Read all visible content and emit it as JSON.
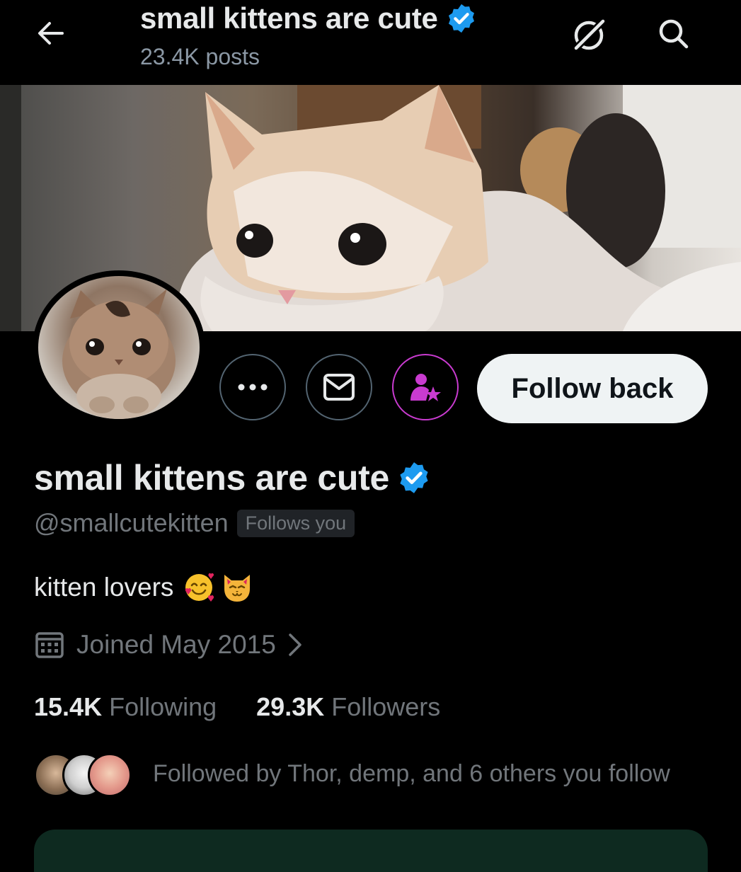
{
  "header": {
    "title": "small kittens are cute",
    "posts": "23.4K posts",
    "back_icon": "arrow-left-icon",
    "grok_icon": "grok-icon",
    "search_icon": "search-icon"
  },
  "profile": {
    "display_name": "small kittens are cute",
    "verified": true,
    "handle": "@smallcutekitten",
    "follows_you": "Follows you",
    "bio_text": "kitten lovers",
    "bio_emojis": "🥰🐱",
    "joined": "Joined May 2015",
    "following_count": "15.4K",
    "following_label": "Following",
    "followers_count": "29.3K",
    "followers_label": "Followers",
    "followed_by": "Followed by Thor, demp, and 6 others you follow"
  },
  "actions": {
    "more_icon": "more-horizontal-icon",
    "message_icon": "envelope-icon",
    "subscribe_icon": "person-star-icon",
    "follow_back": "Follow back"
  },
  "colors": {
    "background": "#000000",
    "verified_blue": "#1d9bf0",
    "subscribe_accent": "#c93bd0",
    "muted_text": "#71767b",
    "button_light": "#eff3f4"
  }
}
